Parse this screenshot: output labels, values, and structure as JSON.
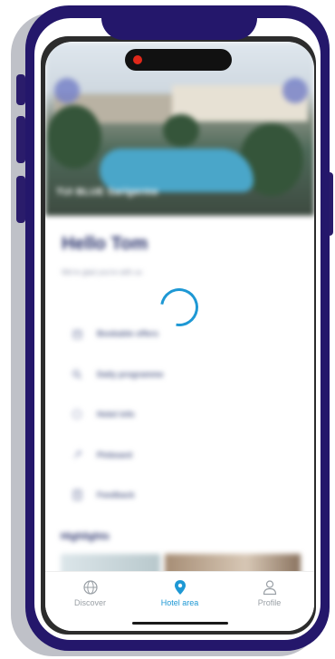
{
  "hero": {
    "caption": "TUI BLUE Sarigerme"
  },
  "greeting": "Hello Tom",
  "subtext": "We're glad you're with us",
  "menu": [
    {
      "label": "Bookable offers",
      "icon": "calendar-icon"
    },
    {
      "label": "Daily programme",
      "icon": "search-icon"
    },
    {
      "label": "Hotel info",
      "icon": "info-icon"
    },
    {
      "label": "Pinboard",
      "icon": "pin-icon"
    },
    {
      "label": "Feedback",
      "icon": "feedback-icon"
    }
  ],
  "highlights_title": "Highlights",
  "tabs": [
    {
      "label": "Discover",
      "icon": "globe-icon",
      "active": false
    },
    {
      "label": "Hotel area",
      "icon": "location-pin-icon",
      "active": true
    },
    {
      "label": "Profile",
      "icon": "user-icon",
      "active": false
    }
  ],
  "colors": {
    "frame": "#24176b",
    "accent": "#1e98d4",
    "heading": "#27306a"
  }
}
